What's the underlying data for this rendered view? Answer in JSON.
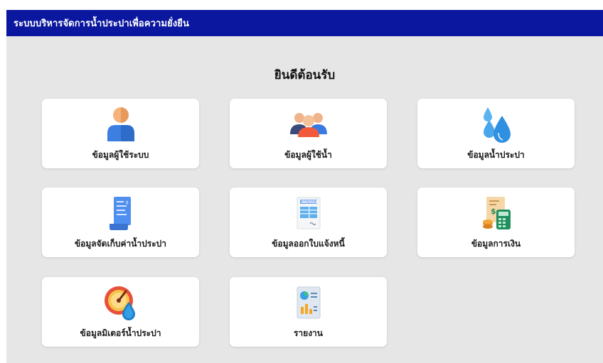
{
  "header": {
    "title": "ระบบบริหารจัดการน้ำประปาเพื่อความยั่งยืน"
  },
  "main": {
    "welcome": "ยินดีต้อนรับ",
    "menu": [
      {
        "label": "ข้อมูลผู้ใช้ระบบ",
        "icon": "user-icon"
      },
      {
        "label": "ข้อมูลผู้ใช้น้ำ",
        "icon": "users-group-icon"
      },
      {
        "label": "ข้อมูลน้ำประปา",
        "icon": "water-drops-icon"
      },
      {
        "label": "ข้อมูลจัดเก็บค่าน้ำประปา",
        "icon": "receipt-icon"
      },
      {
        "label": "ข้อมูลออกใบแจ้งหนี้",
        "icon": "invoice-icon"
      },
      {
        "label": "ข้อมูลการเงิน",
        "icon": "finance-calculator-icon"
      },
      {
        "label": "ข้อมูลมิเตอร์น้ำประปา",
        "icon": "water-meter-gauge-icon"
      },
      {
        "label": "รายงาน",
        "icon": "report-chart-icon"
      }
    ]
  },
  "colors": {
    "header_bg": "#0b179e",
    "page_bg": "#e6e6e6",
    "card_bg": "#ffffff"
  }
}
